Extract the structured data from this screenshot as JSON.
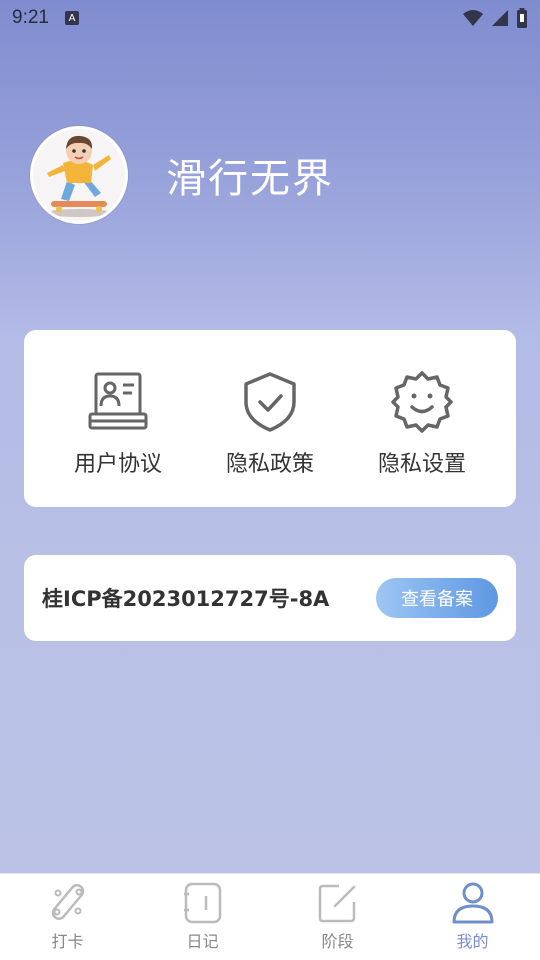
{
  "status_bar": {
    "time": "9:21",
    "notification_badge": "A",
    "icons": [
      "wifi-icon",
      "signal-icon",
      "battery-icon"
    ]
  },
  "profile": {
    "name": "滑行无界",
    "avatar": "avatar-skateboarder"
  },
  "menu": {
    "items": [
      {
        "label": "用户协议",
        "icon": "id-card-icon"
      },
      {
        "label": "隐私政策",
        "icon": "shield-check-icon"
      },
      {
        "label": "隐私设置",
        "icon": "gear-smile-icon"
      }
    ]
  },
  "icp": {
    "text": "桂ICP备2023012727号-8A",
    "button_label": "查看备案",
    "button_color_start": "#9ec6f4",
    "button_color_end": "#5e97e3"
  },
  "bottom_nav": {
    "items": [
      {
        "label": "打卡",
        "icon": "skateboard-icon",
        "active": false
      },
      {
        "label": "日记",
        "icon": "notebook-icon",
        "active": false
      },
      {
        "label": "阶段",
        "icon": "edit-icon",
        "active": false
      },
      {
        "label": "我的",
        "icon": "user-icon",
        "active": true
      }
    ],
    "active_color": "#7b8bd6"
  }
}
